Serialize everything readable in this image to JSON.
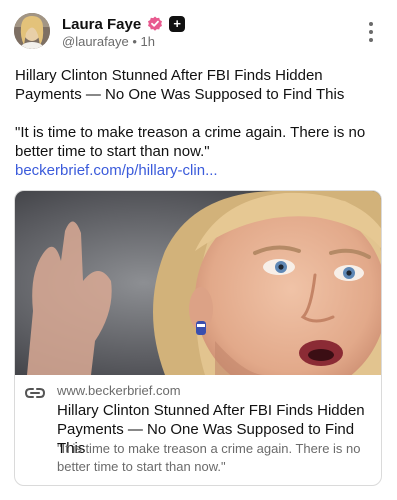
{
  "author": {
    "name": "Laura Faye",
    "handle": "@laurafaye",
    "separator": "•",
    "time": "1h",
    "plus_label": "+"
  },
  "post": {
    "headline": "Hillary Clinton Stunned After FBI Finds Hidden Payments — No One Was Supposed to Find This",
    "quote": "\"It is time to make treason a crime again. There is no better time to start than now.\"",
    "link_text": "beckerbrief.com/p/hillary-clin..."
  },
  "link_card": {
    "domain": "www.beckerbrief.com",
    "title": "Hillary Clinton Stunned After FBI Finds Hidden Payments — No One Was Supposed to Find This",
    "description": "\"It is time to make treason a crime again. There is no better time to start than now.\""
  },
  "icons": {
    "verified": "verified-badge-icon",
    "more": "more-options-icon",
    "link": "link-icon"
  },
  "colors": {
    "link": "#3b5bdb",
    "verified": "#e85a8f",
    "secondary_text": "#6b6b6b",
    "card_border": "#dadada"
  }
}
